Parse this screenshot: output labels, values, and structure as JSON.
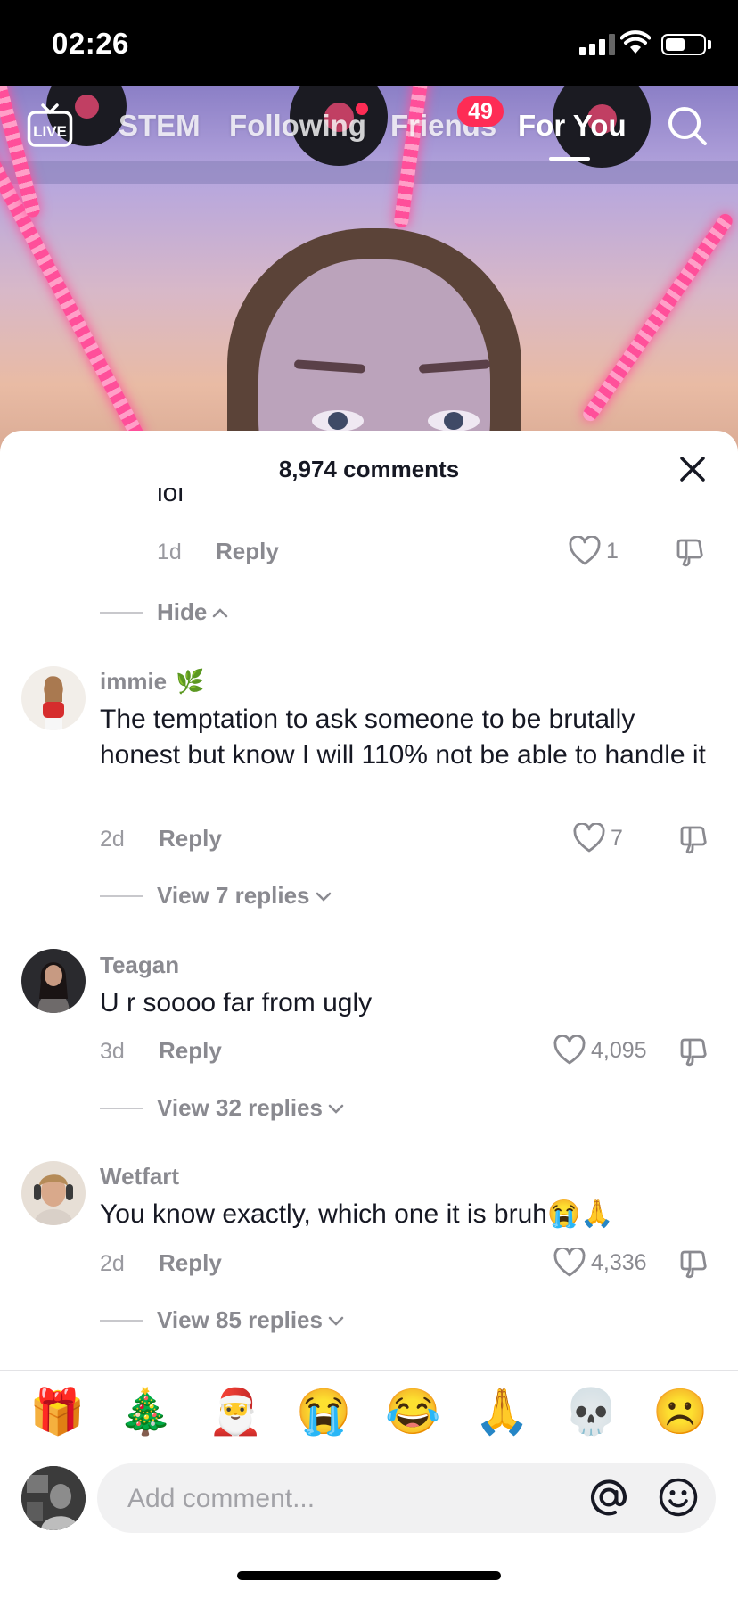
{
  "status_bar": {
    "time": "02:26",
    "battery_level": 0.55
  },
  "top_nav": {
    "live_label": "LIVE",
    "tabs": [
      {
        "label": "STEM",
        "active": false
      },
      {
        "label": "Following",
        "active": false
      },
      {
        "label": "Friends",
        "active": false
      },
      {
        "label": "For You",
        "active": true
      }
    ],
    "friends_badge": "49"
  },
  "comments_sheet": {
    "title": "8,974 comments",
    "partial_reply": {
      "text": "lol",
      "age": "1d",
      "reply_label": "Reply",
      "likes": "1",
      "hide_label": "Hide"
    },
    "comments": [
      {
        "username": "immie",
        "username_emoji": "🌿",
        "text": "The temptation to ask someone to be brutally honest but know I will 110% not be able to handle it",
        "age": "2d",
        "reply_label": "Reply",
        "likes": "7",
        "view_replies": "View 7 replies"
      },
      {
        "username": "Teagan",
        "text": "U r soooo far from ugly",
        "age": "3d",
        "reply_label": "Reply",
        "likes": "4,095",
        "view_replies": "View 32 replies"
      },
      {
        "username": "Wetfart",
        "text": "You know exactly, which one it is bruh😭🙏",
        "age": "2d",
        "reply_label": "Reply",
        "likes": "4,336",
        "view_replies": "View 85 replies"
      }
    ],
    "emoji_bar": [
      "🎁",
      "🎄",
      "🎅",
      "😭",
      "😂",
      "🙏",
      "💀",
      "☹️"
    ],
    "input": {
      "placeholder": "Add comment..."
    }
  },
  "icons": {
    "live": "live-tv-icon",
    "search": "search-icon",
    "close": "close-icon",
    "like": "heart-outline-icon",
    "dislike": "thumbs-down-icon",
    "mention": "at-sign-icon",
    "emoji": "smiley-face-icon"
  },
  "colors": {
    "accent": "#fe2c55",
    "text_primary": "#161823",
    "text_secondary": "#8a8a90"
  }
}
